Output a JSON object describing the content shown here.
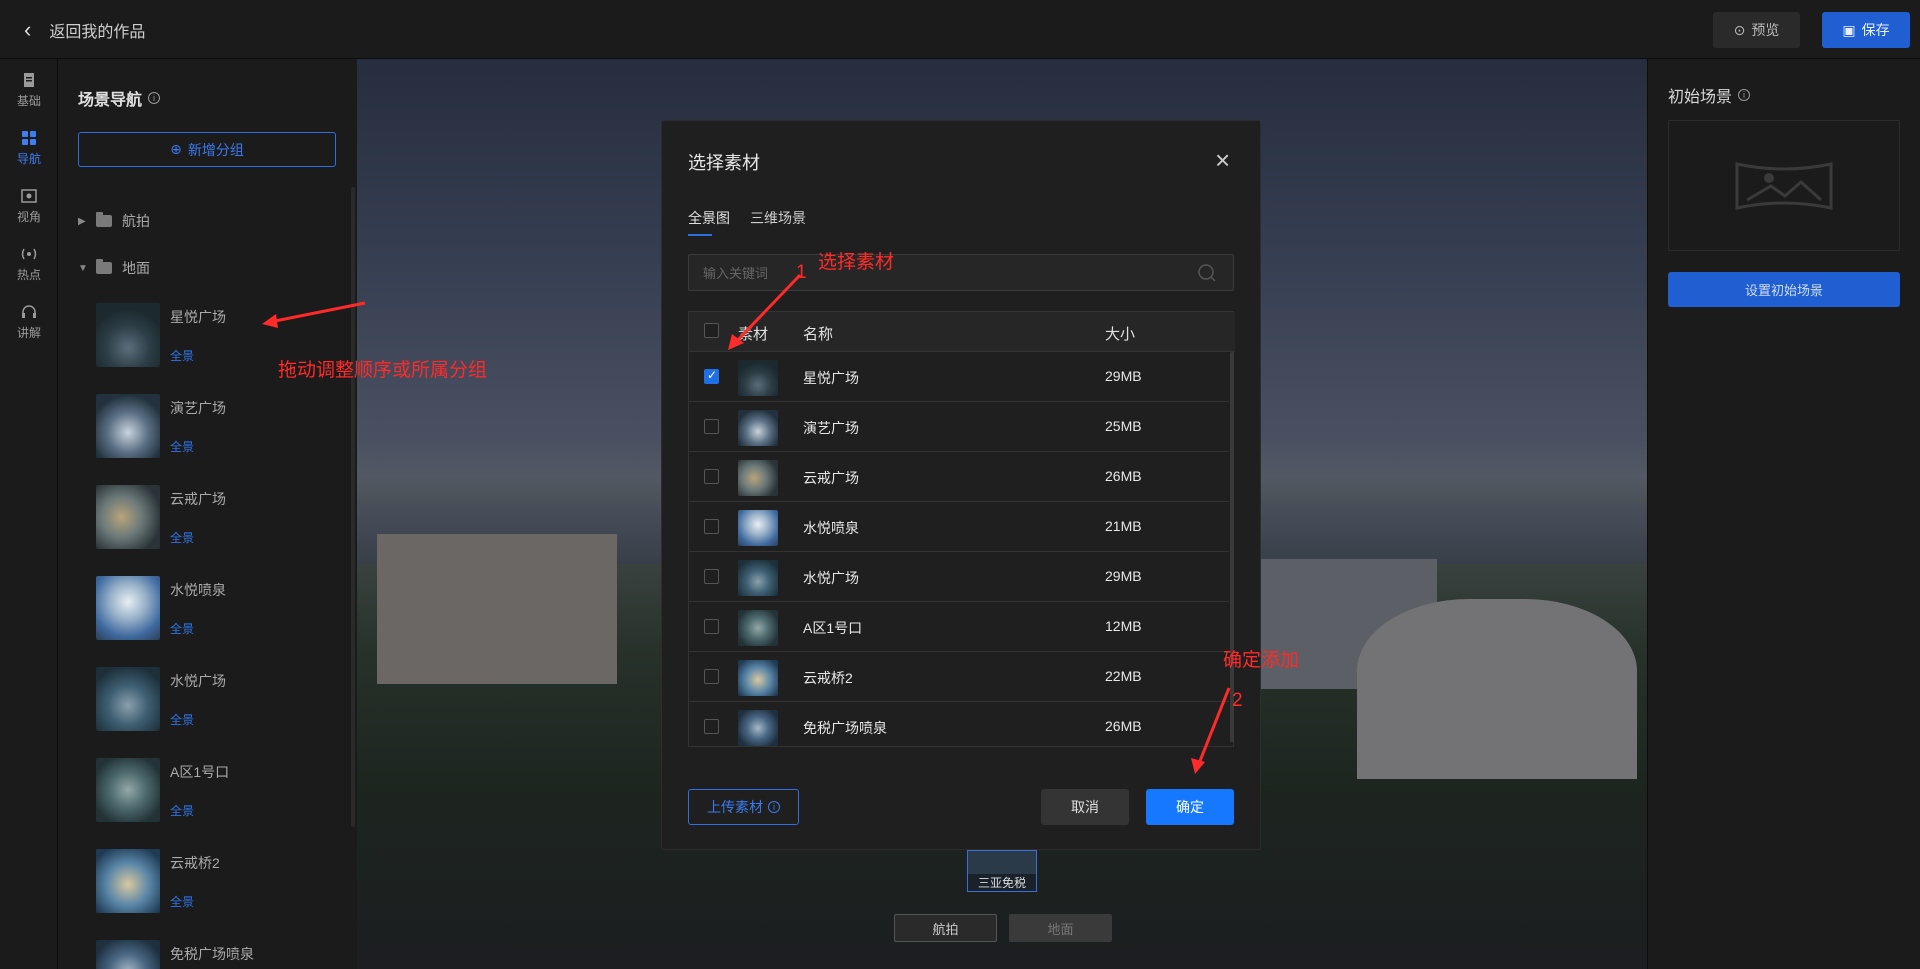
{
  "topbar": {
    "back_label": "返回我的作品",
    "preview_label": "预览",
    "save_label": "保存"
  },
  "rail": [
    "基础",
    "导航",
    "视角",
    "热点",
    "讲解"
  ],
  "sidebar": {
    "title": "场景导航",
    "add_group_label": "新增分组",
    "groups": [
      "航拍",
      "地面"
    ],
    "scenes": [
      {
        "name": "星悦广场",
        "tag": "全景"
      },
      {
        "name": "演艺广场",
        "tag": "全景"
      },
      {
        "name": "云戒广场",
        "tag": "全景"
      },
      {
        "name": "水悦喷泉",
        "tag": "全景"
      },
      {
        "name": "水悦广场",
        "tag": "全景"
      },
      {
        "name": "A区1号口",
        "tag": "全景"
      },
      {
        "name": "云戒桥2",
        "tag": "全景"
      },
      {
        "name": "免税广场喷泉",
        "tag": ""
      }
    ]
  },
  "viewer": {
    "mini_label": "三亚免税",
    "tabs": [
      "航拍",
      "地面"
    ]
  },
  "rightpanel": {
    "title": "初始场景",
    "button_label": "设置初始场景"
  },
  "dialog": {
    "title": "选择素材",
    "tabs": [
      "全景图",
      "三维场景"
    ],
    "search_placeholder": "输入关键词",
    "columns": {
      "material": "素材",
      "name": "名称",
      "size": "大小"
    },
    "rows": [
      {
        "name": "星悦广场",
        "size": "29MB",
        "checked": true
      },
      {
        "name": "演艺广场",
        "size": "25MB",
        "checked": false
      },
      {
        "name": "云戒广场",
        "size": "26MB",
        "checked": false
      },
      {
        "name": "水悦喷泉",
        "size": "21MB",
        "checked": false
      },
      {
        "name": "水悦广场",
        "size": "29MB",
        "checked": false
      },
      {
        "name": "A区1号口",
        "size": "12MB",
        "checked": false
      },
      {
        "name": "云戒桥2",
        "size": "22MB",
        "checked": false
      },
      {
        "name": "免税广场喷泉",
        "size": "26MB",
        "checked": false
      }
    ],
    "upload_label": "上传素材",
    "cancel_label": "取消",
    "confirm_label": "确定"
  },
  "annotations": {
    "drag_hint": "拖动调整顺序或所属分组",
    "select_hint": "选择素材",
    "confirm_hint": "确定添加",
    "step1": "1",
    "step2": "2"
  },
  "colors": {
    "accent": "#1677ff",
    "annotation": "#ff2a2a"
  }
}
